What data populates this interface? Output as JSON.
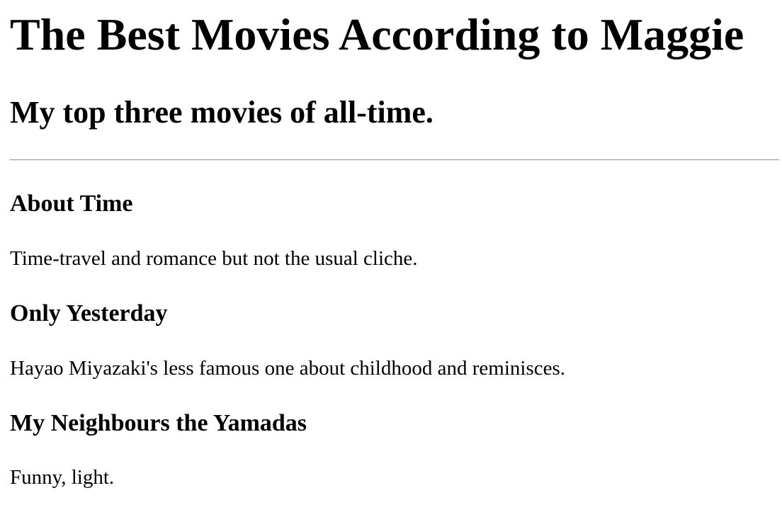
{
  "header": {
    "title": "The Best Movies According to Maggie",
    "subtitle": "My top three movies of all-time."
  },
  "movies": [
    {
      "title": "About Time",
      "description": "Time-travel and romance but not the usual cliche."
    },
    {
      "title": "Only Yesterday",
      "description": "Hayao Miyazaki's less famous one about childhood and reminisces."
    },
    {
      "title": "My Neighbours the Yamadas",
      "description": "Funny, light."
    }
  ]
}
